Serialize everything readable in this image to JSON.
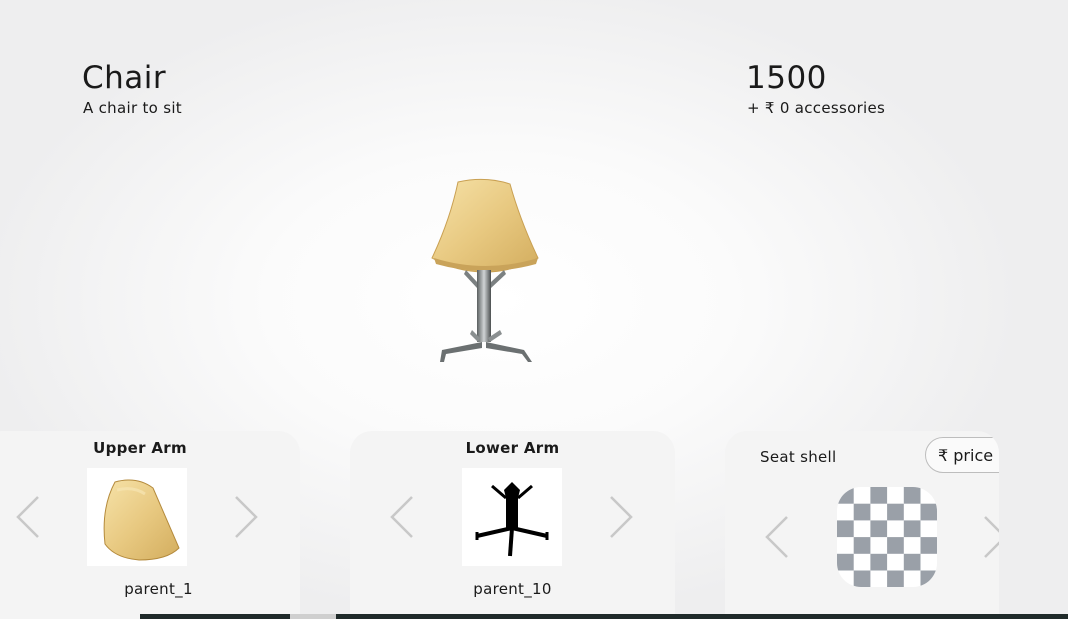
{
  "product": {
    "title": "Chair",
    "description": "A chair to sit"
  },
  "pricing": {
    "total": "1500",
    "accessories": "+ ₹ 0 accessories"
  },
  "cards": [
    {
      "title": "Upper Arm",
      "selected": "parent_1",
      "thumb_icon": "seat-shell-thumbnail"
    },
    {
      "title": "Lower Arm",
      "selected": "parent_10",
      "thumb_icon": "chair-base-thumbnail"
    },
    {
      "title": "Seat shell",
      "price_button": "₹ price",
      "thumb_icon": "transparent-placeholder"
    }
  ],
  "colors": {
    "accent_dark": "#1f2a2a",
    "card_bg": "#f4f4f4",
    "wood": "#e8c981"
  }
}
